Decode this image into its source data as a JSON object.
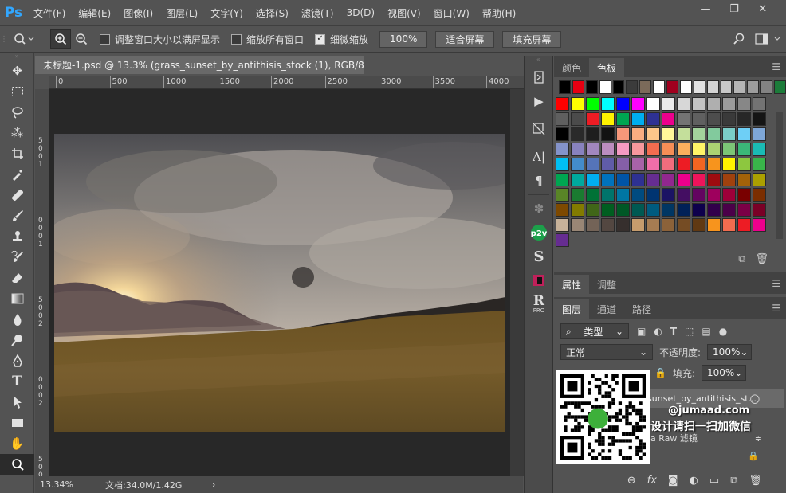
{
  "app": {
    "logo": "Ps"
  },
  "menu": [
    "文件(F)",
    "编辑(E)",
    "图像(I)",
    "图层(L)",
    "文字(Y)",
    "选择(S)",
    "滤镜(T)",
    "3D(D)",
    "视图(V)",
    "窗口(W)",
    "帮助(H)"
  ],
  "window_controls": {
    "minimize": "—",
    "restore": "❐",
    "close": "✕"
  },
  "options": {
    "resize_windows": "调整窗口大小以满屏显示",
    "zoom_all": "缩放所有窗口",
    "scrubby_zoom": "细微缩放",
    "scrubby_checked": true,
    "percent_button": "100%",
    "fit_screen": "适合屏幕",
    "fill_screen": "填充屏幕"
  },
  "document": {
    "tab_title": "未标题-1.psd @ 13.3% (grass_sunset_by_antithisis_stock (1), RGB/8#) *",
    "close": "×",
    "ruler_h": [
      "0",
      "500",
      "1000",
      "1500",
      "2000",
      "2500",
      "3000",
      "3500",
      "4000"
    ],
    "ruler_v": [
      "5",
      "0",
      "0",
      "1",
      "0",
      "0",
      "0",
      "1",
      "5",
      "0",
      "0",
      "2",
      "0",
      "0",
      "0",
      "2",
      "5",
      "0",
      "0"
    ]
  },
  "status": {
    "zoom": "13.34%",
    "doc_size": "文档:34.0M/1.42G",
    "arrow": "›"
  },
  "panels": {
    "color_tabs": [
      "颜色",
      "色板"
    ],
    "props_tabs": [
      "属性",
      "调整"
    ],
    "layer_tabs": [
      "图层",
      "通道",
      "路径"
    ],
    "kind_label": "类型",
    "blend_mode": "正常",
    "opacity_label": "不透明度:",
    "opacity_value": "100%",
    "fill_label": "填充:",
    "fill_value": "100%",
    "layer_name": "sunset_by_antithisis_st...",
    "filter_name": "a Raw 滤镜"
  },
  "watermark": {
    "site": "@jumaad.com",
    "text": "设计请扫一扫加微信"
  },
  "swatches": {
    "recent": [
      "#000000",
      "#e60012",
      "#000000",
      "#ffffff",
      "#000000",
      "#3b3b3b",
      "#7b6a5a",
      "#ffffff",
      "#a0001e",
      "#ffffff",
      "#e2e2e2",
      "#d4d4d4",
      "#c8c8c8",
      "#b5b5b5",
      "#9d9d9d",
      "#838383",
      "#1c7c3a"
    ],
    "grid": [
      "#ff0000",
      "#ffff00",
      "#00ff00",
      "#00ffff",
      "#0000ff",
      "#ff00ff",
      "#ffffff",
      "#ebebeb",
      "#d7d7d7",
      "#c3c3c3",
      "#afafaf",
      "#9b9b9b",
      "#878787",
      "#737373",
      "#5f5f5f",
      "#4b4b4b",
      "#ed1c24",
      "#fff200",
      "#00a651",
      "#00aeef",
      "#2e3192",
      "#ec008c",
      "#737373",
      "#606060",
      "#4d4d4d",
      "#3a3a3a",
      "#272727",
      "#141414",
      "#000000",
      "#2a2a2a",
      "#1e1e1e",
      "#121212",
      "#f7977a",
      "#f9ad81",
      "#fdc68a",
      "#fff79a",
      "#c4df9b",
      "#a3d39c",
      "#82ca9d",
      "#7bcdc8",
      "#6ecff6",
      "#7ea7d8",
      "#8493ca",
      "#8882be",
      "#a187be",
      "#bc8dbf",
      "#f49ac2",
      "#f6989d",
      "#f26c4f",
      "#f68e56",
      "#fbaf5d",
      "#fff467",
      "#acd372",
      "#7cc576",
      "#3bb878",
      "#1abbb4",
      "#00bff3",
      "#438ccb",
      "#5574b9",
      "#605ca8",
      "#855fa8",
      "#a763a8",
      "#f06ea9",
      "#f26d7d",
      "#ed1c24",
      "#f26522",
      "#f7941d",
      "#fff200",
      "#8dc73f",
      "#39b54a",
      "#00a651",
      "#00a99d",
      "#00aeef",
      "#0072bc",
      "#0054a6",
      "#2e3192",
      "#662d91",
      "#92278f",
      "#ec008c",
      "#ed145b",
      "#9e0b0f",
      "#a0410d",
      "#a36209",
      "#aba000",
      "#598527",
      "#1a7b30",
      "#007236",
      "#00746b",
      "#0076a3",
      "#004b80",
      "#003471",
      "#1b1464",
      "#440e62",
      "#630460",
      "#9e005d",
      "#9e0039",
      "#790000",
      "#7b2e00",
      "#7d4900",
      "#827b00",
      "#406618",
      "#005e20",
      "#005826",
      "#005952",
      "#005b7f",
      "#003663",
      "#002157",
      "#0d004c",
      "#32004b",
      "#4b0049",
      "#7b0046",
      "#7a0026",
      "#c7b299",
      "#998675",
      "#736357",
      "#534741",
      "#362f2d",
      "#c69c6d",
      "#a67c52",
      "#8c6239",
      "#754c24",
      "#603913",
      "#f7941d",
      "#f26c4f",
      "#ed1c24",
      "#ec008c",
      "#662d91"
    ]
  }
}
